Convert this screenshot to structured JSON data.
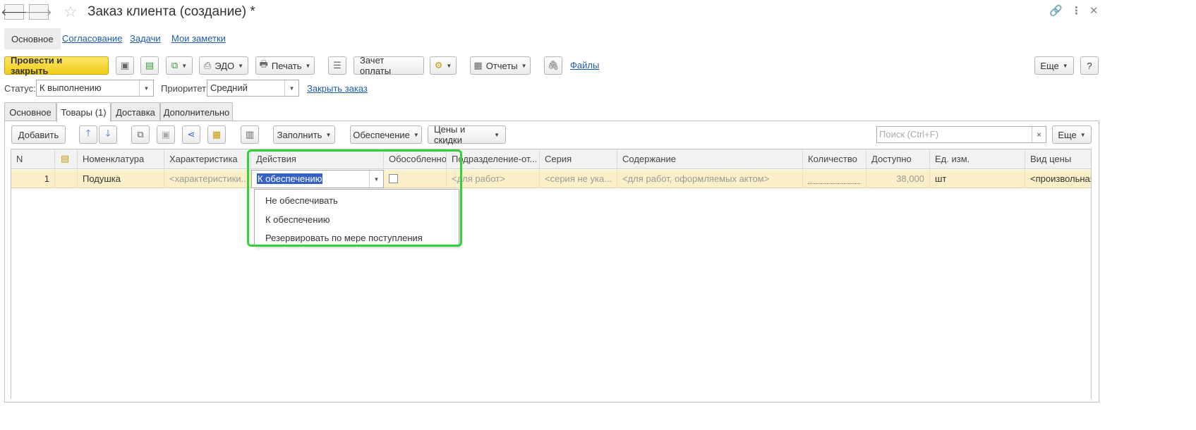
{
  "window": {
    "title": "Заказ клиента (создание) *"
  },
  "icons": {
    "back": "arrow-left-icon",
    "forward": "arrow-right-icon",
    "favorite": "star-icon",
    "link": "link-icon",
    "menu": "more-vert-icon",
    "close": "close-icon"
  },
  "section_nav": {
    "items": [
      "Основное",
      "Согласование",
      "Задачи",
      "Мои заметки"
    ],
    "active": "Основное"
  },
  "toolbar": {
    "post_close": "Провести и закрыть",
    "edo": "ЭДО",
    "print": "Печать",
    "offset": "Зачет оплаты",
    "reports": "Отчеты",
    "files": "Файлы",
    "more": "Еще",
    "help": "?"
  },
  "status_row": {
    "status_label": "Статус:",
    "status_value": "К выполнению",
    "priority_label": "Приоритет:",
    "priority_value": "Средний",
    "close_order": "Закрыть заказ"
  },
  "tabs": {
    "items": [
      "Основное",
      "Товары (1)",
      "Доставка",
      "Дополнительно"
    ],
    "active": "Товары (1)"
  },
  "goods_toolbar": {
    "add": "Добавить",
    "fill": "Заполнить",
    "supply": "Обеспечение",
    "prices": "Цены и скидки",
    "search_placeholder": "Поиск (Ctrl+F)",
    "search_clear": "×",
    "more": "Еще"
  },
  "grid": {
    "columns": [
      "N",
      "",
      "Номенклатура",
      "Характеристика",
      "Действия",
      "Обособленно",
      "Подразделение-от...",
      "Серия",
      "Содержание",
      "Количество",
      "Доступно",
      "Ед. изм.",
      "Вид цены"
    ],
    "rows": [
      {
        "n": "1",
        "item": "Подушка",
        "characteristic": "<характеристики...",
        "action": "К обеспечению",
        "separate": false,
        "department": "<для работ>",
        "series": "<серия не ука...",
        "content": "<для работ, оформляемых актом>",
        "quantity": "",
        "available": "38,000",
        "unit": "шт",
        "price_type": "<произвольная>"
      }
    ]
  },
  "dropdown": {
    "options": [
      "Не обеспечивать",
      "К обеспечению",
      "Резервировать по мере поступления"
    ]
  },
  "colors": {
    "primary_button": "#f2cd16",
    "link": "#1d5bab",
    "row_highlight": "#fbf0c9",
    "annotation_frame": "#33d23b",
    "selection": "#3661c7"
  }
}
